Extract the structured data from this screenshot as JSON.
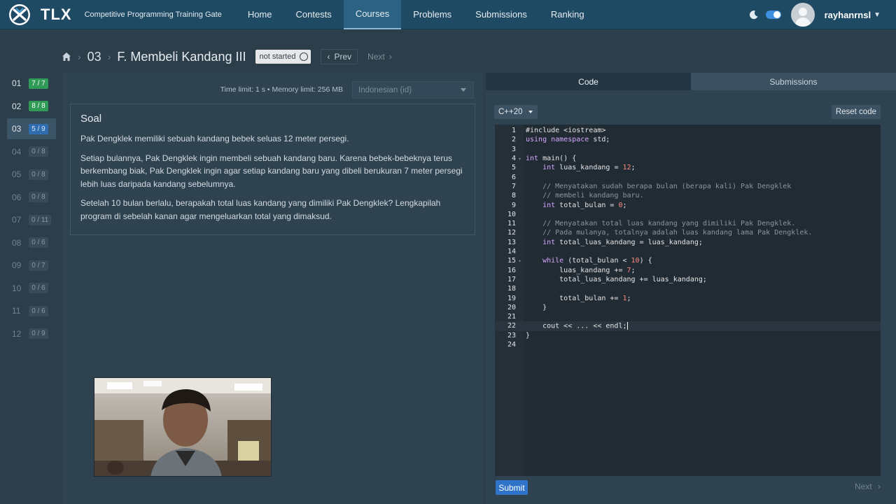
{
  "navbar": {
    "brand": "TLX",
    "tagline": "Competitive Programming Training Gate",
    "items": [
      {
        "label": "Home",
        "active": false
      },
      {
        "label": "Contests",
        "active": false
      },
      {
        "label": "Courses",
        "active": true
      },
      {
        "label": "Problems",
        "active": false
      },
      {
        "label": "Submissions",
        "active": false
      },
      {
        "label": "Ranking",
        "active": false
      }
    ],
    "username": "rayhanrnsl",
    "icons": {
      "theme": "moon-icon",
      "toggle": "dark-mode-toggle",
      "user": "avatar",
      "menu": "chevron-down-icon"
    }
  },
  "breadcrumb": {
    "chapter": "03",
    "title": "F. Membeli Kandang III",
    "status": "not started",
    "prev": "Prev",
    "next": "Next"
  },
  "problem_list": [
    {
      "num": "01",
      "score": "7 / 7",
      "state": "done"
    },
    {
      "num": "02",
      "score": "8 / 8",
      "state": "done"
    },
    {
      "num": "03",
      "score": "5 / 9",
      "state": "partial"
    },
    {
      "num": "04",
      "score": "0 / 8",
      "state": "zero"
    },
    {
      "num": "05",
      "score": "0 / 8",
      "state": "zero"
    },
    {
      "num": "06",
      "score": "0 / 8",
      "state": "zero"
    },
    {
      "num": "07",
      "score": "0 / 11",
      "state": "zero"
    },
    {
      "num": "08",
      "score": "0 / 6",
      "state": "zero"
    },
    {
      "num": "09",
      "score": "0 / 7",
      "state": "zero"
    },
    {
      "num": "10",
      "score": "0 / 6",
      "state": "zero"
    },
    {
      "num": "11",
      "score": "0 / 6",
      "state": "zero"
    },
    {
      "num": "12",
      "score": "0 / 9",
      "state": "zero"
    }
  ],
  "problem": {
    "limits": "Time limit: 1 s  •  Memory limit: 256 MB",
    "language": "Indonesian (id)",
    "heading": "Soal",
    "paragraphs": [
      "Pak Dengklek memiliki sebuah kandang bebek seluas 12 meter persegi.",
      "Setiap bulannya, Pak Dengklek ingin membeli sebuah kandang baru. Karena bebek-bebeknya terus berkembang biak, Pak Dengklek ingin agar setiap kandang baru yang dibeli berukuran 7 meter persegi lebih luas daripada kandang sebelumnya.",
      "Setelah 10 bulan berlalu, berapakah total luas kandang yang dimiliki Pak Dengklek? Lengkapilah program di sebelah kanan agar mengeluarkan total yang dimaksud."
    ]
  },
  "editor": {
    "tabs": [
      {
        "label": "Code",
        "active": true
      },
      {
        "label": "Submissions",
        "active": false
      }
    ],
    "language": "C++20",
    "reset": "Reset code",
    "submit": "Submit",
    "next": "Next",
    "code_lines": [
      "#include <iostream>",
      "using namespace std;",
      "",
      "int main() {",
      "    int luas_kandang = 12;",
      "",
      "    // Menyatakan sudah berapa bulan (berapa kali) Pak Dengklek",
      "    // membeli kandang baru.",
      "    int total_bulan = 0;",
      "",
      "    // Menyatakan total luas kandang yang dimiliki Pak Dengklek.",
      "    // Pada mulanya, totalnya adalah luas kandang lama Pak Dengklek.",
      "    int total_luas_kandang = luas_kandang;",
      "",
      "    while (total_bulan < 10) {",
      "        luas_kandang += 7;",
      "        total_luas_kandang += luas_kandang;",
      "",
      "        total_bulan += 1;",
      "    }",
      "",
      "    cout << ... << endl;",
      "}",
      ""
    ],
    "fold_lines": [
      4,
      15
    ],
    "current_line": 22
  }
}
